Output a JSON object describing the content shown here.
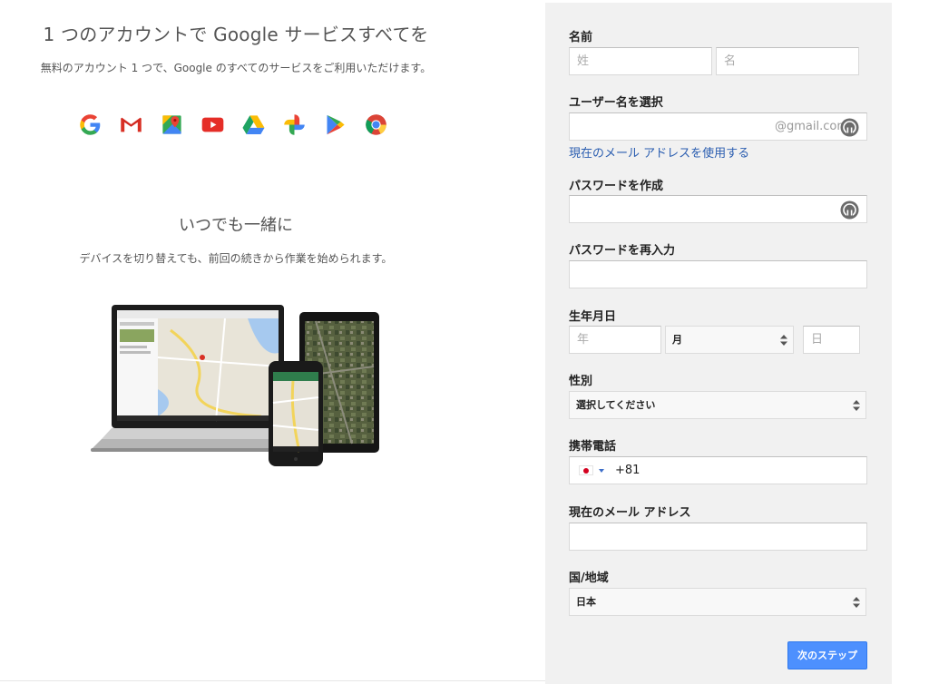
{
  "left": {
    "headline": "1 つのアカウントで Google サービスすべてを",
    "subline": "無料のアカウント 1 つで、Google のすべてのサービスをご利用いただけます。",
    "logos": [
      "google-g-icon",
      "gmail-icon",
      "maps-icon",
      "youtube-icon",
      "drive-icon",
      "photos-icon",
      "play-icon",
      "chrome-icon"
    ],
    "tagline": "いつでも一緒に",
    "tagline_sub": "デバイスを切り替えても、前回の続きから作業を始められます。"
  },
  "form": {
    "name": {
      "label": "名前",
      "last_placeholder": "姓",
      "first_placeholder": "名"
    },
    "username": {
      "label": "ユーザー名を選択",
      "suffix": "@gmail.com",
      "link": "現在のメール アドレスを使用する"
    },
    "password": {
      "label": "パスワードを作成"
    },
    "confirm": {
      "label": "パスワードを再入力"
    },
    "birthday": {
      "label": "生年月日",
      "year_placeholder": "年",
      "month_value": "月",
      "day_placeholder": "日"
    },
    "gender": {
      "label": "性別",
      "value": "選択してください"
    },
    "phone": {
      "label": "携帯電話",
      "value": "+81"
    },
    "email": {
      "label": "現在のメール アドレス"
    },
    "country": {
      "label": "国/地域",
      "value": "日本"
    },
    "next_button": "次のステップ"
  },
  "colors": {
    "panel_bg": "#f1f1f1",
    "link": "#2a5db0",
    "button": "#4d90fe"
  }
}
